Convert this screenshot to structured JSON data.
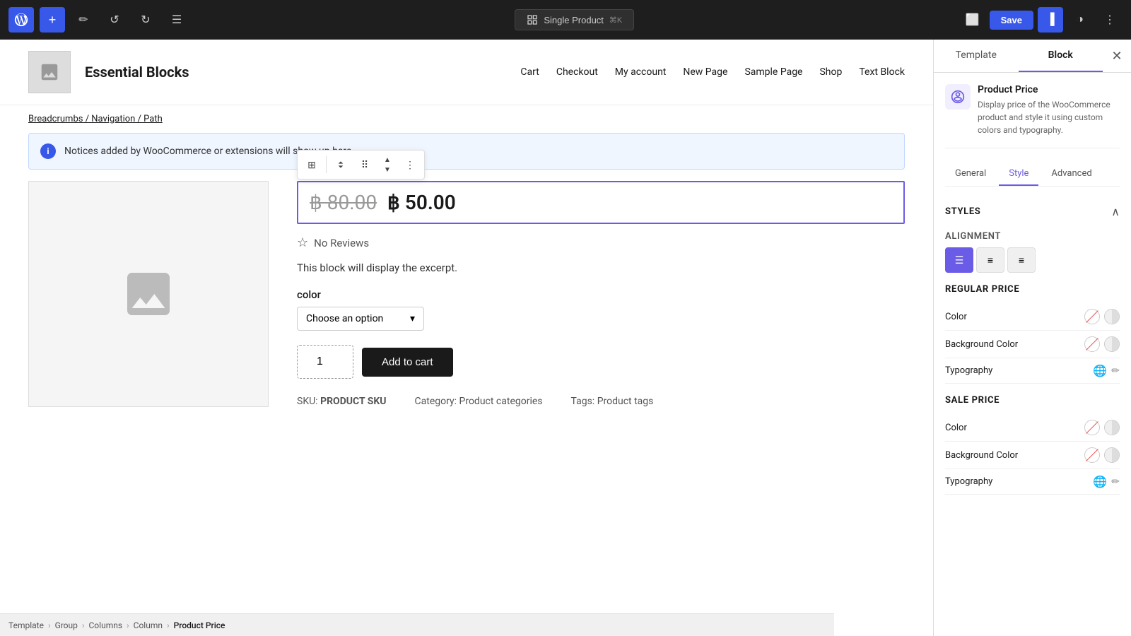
{
  "topbar": {
    "site_url": "Single Product",
    "keyboard_shortcut": "⌘K",
    "save_label": "Save"
  },
  "nav": {
    "logo_alt": "Essential Blocks",
    "site_name": "Essential Blocks",
    "items": [
      {
        "label": "Cart"
      },
      {
        "label": "Checkout"
      },
      {
        "label": "My account"
      },
      {
        "label": "New Page"
      },
      {
        "label": "Sample Page"
      },
      {
        "label": "Shop"
      },
      {
        "label": "Text Block"
      }
    ]
  },
  "breadcrumb": {
    "text": "Breadcrumbs / Navigation / Path"
  },
  "notice": {
    "text": "Notices added by WooCommerce or extensions will show up here."
  },
  "product": {
    "price_regular": "฿ 80.00",
    "price_sale": "฿ 50.00",
    "reviews": "No Reviews",
    "excerpt": "This block will display the excerpt.",
    "color_label": "color",
    "color_select_default": "Choose an option",
    "qty_value": "1",
    "add_to_cart": "Add to cart",
    "sku_label": "SKU:",
    "sku_value": "PRODUCT SKU",
    "category_label": "Category:",
    "category_value": "Product categories",
    "tags_label": "Tags:",
    "tags_value": "Product tags"
  },
  "right_panel": {
    "tab_template": "Template",
    "tab_block": "Block",
    "block_name": "Product Price",
    "block_description": "Display price of the WooCommerce product and style it using custom colors and typography.",
    "sub_tabs": [
      "General",
      "Style",
      "Advanced"
    ],
    "active_sub_tab": "Style",
    "styles_section": "Styles",
    "alignment_label": "ALIGNMENT",
    "alignment_options": [
      "left",
      "center",
      "right"
    ],
    "active_alignment": "left",
    "regular_price_label": "REGULAR PRICE",
    "sale_price_label": "SALE PRICE",
    "props": {
      "color": "Color",
      "background_color": "Background Color",
      "typography": "Typography"
    }
  },
  "bottom_breadcrumb": {
    "items": [
      "Template",
      "Group",
      "Columns",
      "Column",
      "Product Price"
    ]
  }
}
